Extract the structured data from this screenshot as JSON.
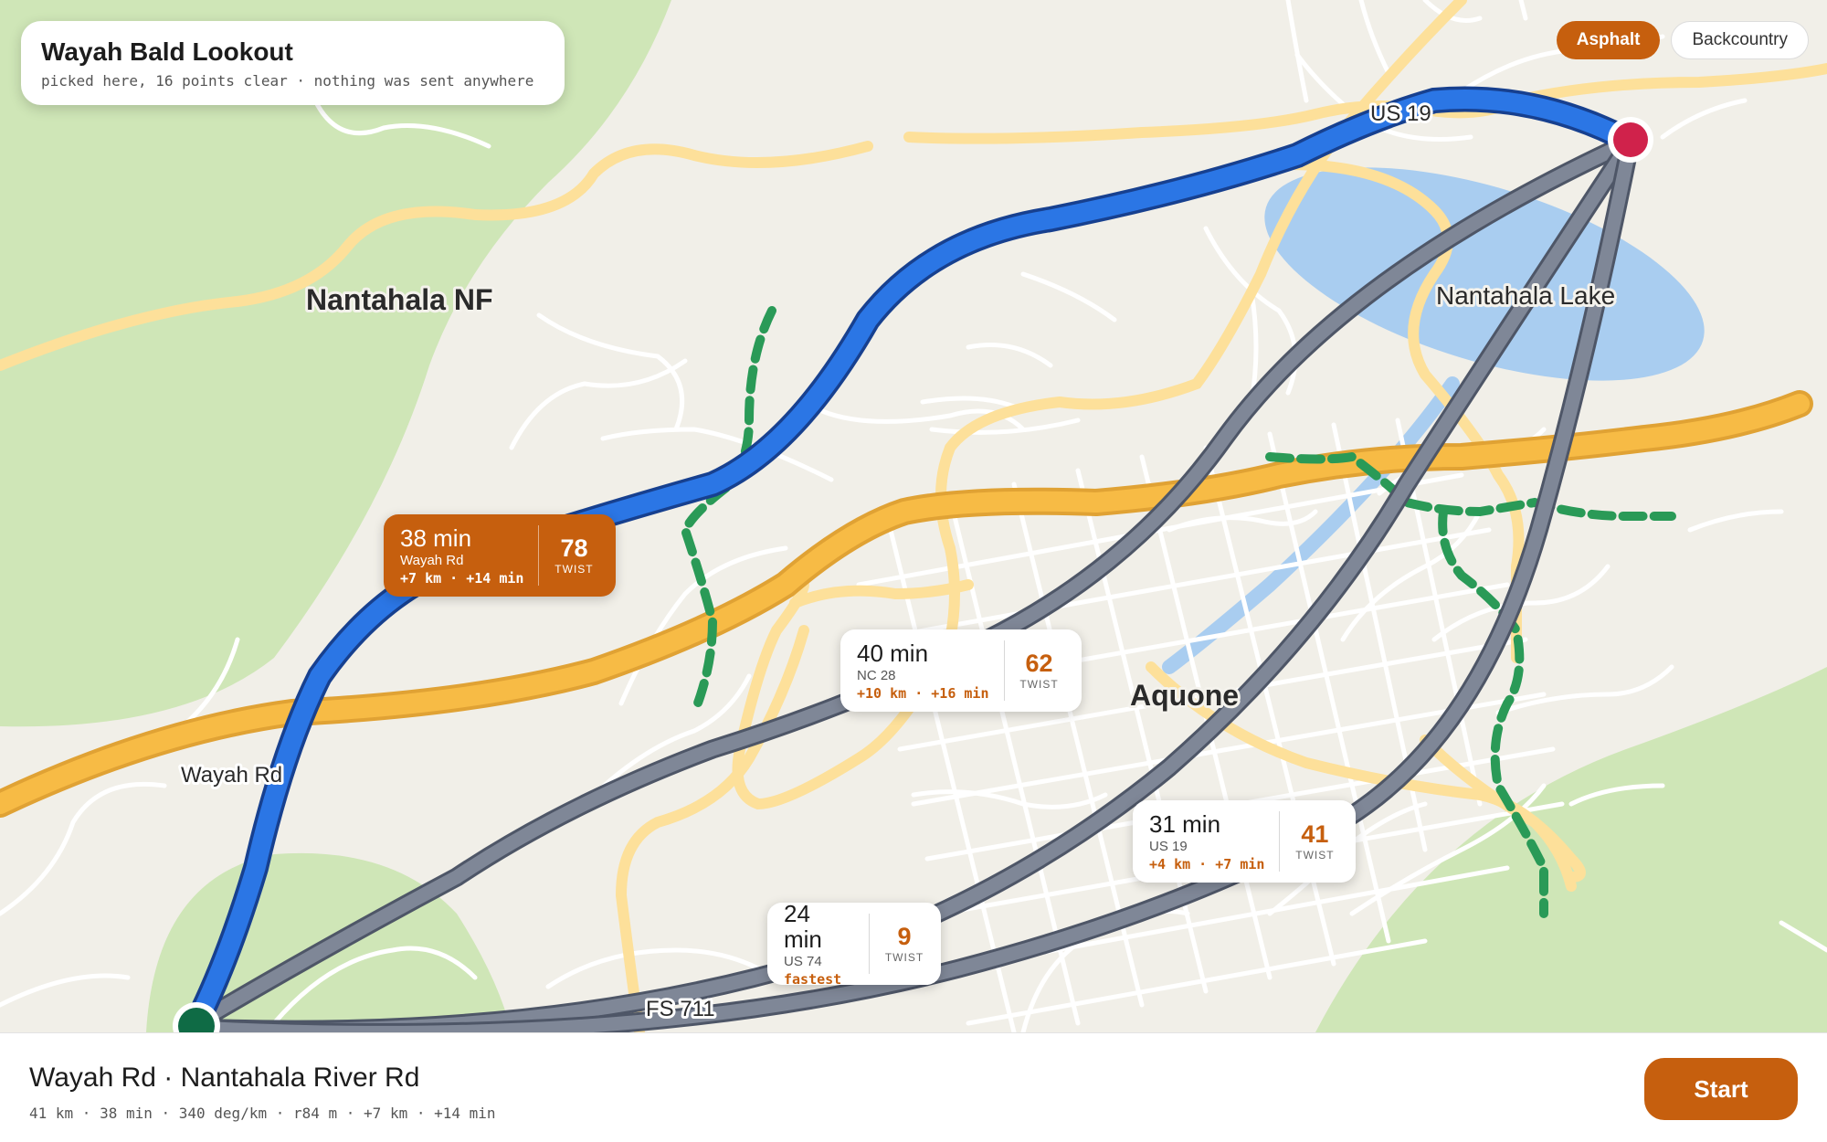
{
  "header": {
    "title": "Wayah Bald Lookout",
    "subtitle": "picked here, 16 points clear · nothing was sent anywhere"
  },
  "mode_toggle": {
    "options": [
      "Asphalt",
      "Backcountry"
    ],
    "selected": "Asphalt",
    "accent_color": "#c65f0e"
  },
  "map": {
    "labels": {
      "forest": "Nantahala NF",
      "lake": "Nantahala Lake",
      "town": "Aquone",
      "road_us19": "US 19",
      "road_wayah": "Wayah Rd",
      "road_fs711": "FS 711"
    },
    "colors": {
      "selected_route": "#2b76e5",
      "alternate_route": "#7f8797",
      "highway": "#f3b53f",
      "water": "#a9cdf0",
      "forest": "#cfe6b7",
      "trail": "#2a9a57",
      "destination_pin": "#d0224b",
      "origin_pin": "#0f6b45"
    }
  },
  "routes": [
    {
      "time": "38 min",
      "road": "Wayah Rd",
      "delta": "+7 km · +14 min",
      "twist": "78",
      "twist_label": "TWIST",
      "selected": true
    },
    {
      "time": "40 min",
      "road": "NC 28",
      "delta": "+10 km · +16 min",
      "twist": "62",
      "twist_label": "TWIST",
      "selected": false
    },
    {
      "time": "31 min",
      "road": "US 19",
      "delta": "+4 km · +7 min",
      "twist": "41",
      "twist_label": "TWIST",
      "selected": false
    },
    {
      "time": "24 min",
      "road": "US 74",
      "delta": "fastest",
      "twist": "9",
      "twist_label": "TWIST",
      "selected": false
    }
  ],
  "summary": {
    "route_name": "Wayah Rd · Nantahala River Rd",
    "stats": "41 km · 38 min · 340 deg/km · r84 m · +7 km · +14 min",
    "start_label": "Start"
  }
}
